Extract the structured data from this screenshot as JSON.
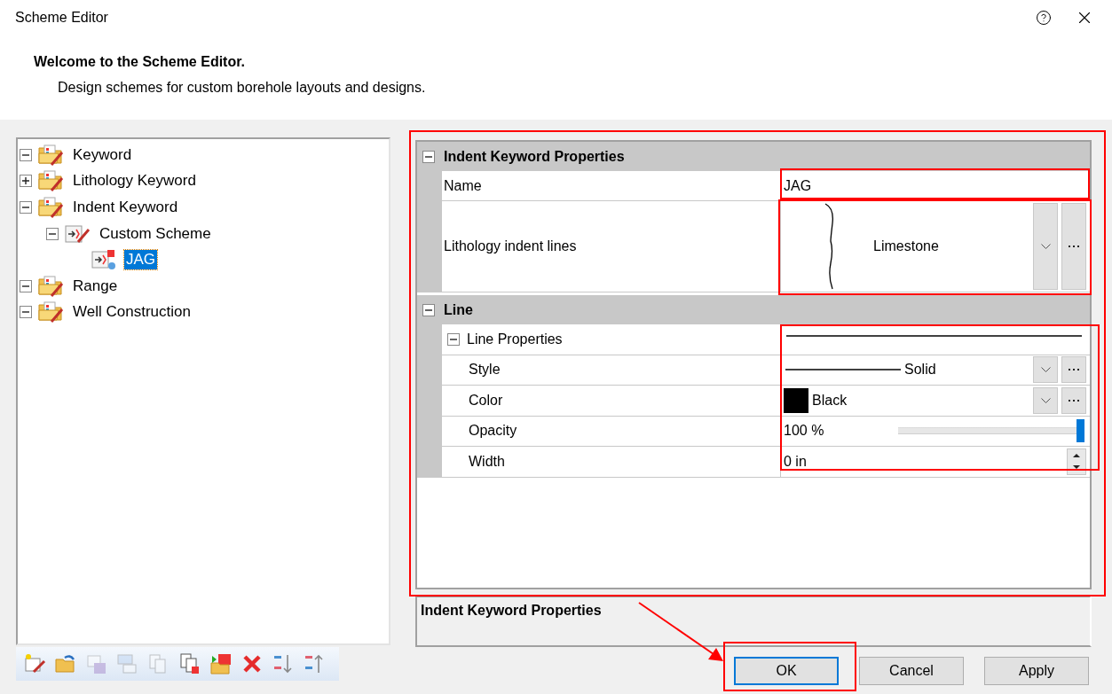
{
  "window": {
    "title": "Scheme Editor"
  },
  "header": {
    "title": "Welcome to the Scheme Editor.",
    "subtitle": "Design schemes for custom borehole layouts and designs."
  },
  "tree": [
    {
      "label": "Keyword",
      "kind": "folder",
      "expanded": true,
      "selected": false
    },
    {
      "label": "Lithology Keyword",
      "kind": "folder",
      "expanded": false,
      "selected": false
    },
    {
      "label": "Indent Keyword",
      "kind": "folder",
      "expanded": true,
      "selected": false,
      "children": [
        {
          "label": "Custom Scheme",
          "kind": "scheme",
          "expanded": true,
          "selected": false,
          "children": [
            {
              "label": "JAG",
              "kind": "item",
              "selected": true
            }
          ]
        }
      ]
    },
    {
      "label": "Range",
      "kind": "folder",
      "expanded": true,
      "selected": false
    },
    {
      "label": "Well Construction",
      "kind": "folder",
      "expanded": true,
      "selected": false
    }
  ],
  "toolbar": [
    {
      "kind": "new",
      "disabled": false
    },
    {
      "kind": "open",
      "disabled": false
    },
    {
      "kind": "save",
      "disabled": true
    },
    {
      "kind": "layout",
      "disabled": true
    },
    {
      "kind": "copy",
      "disabled": true
    },
    {
      "kind": "paste",
      "disabled": false
    },
    {
      "kind": "import",
      "disabled": false
    },
    {
      "kind": "delete",
      "disabled": false
    },
    {
      "kind": "sort-up",
      "disabled": false
    },
    {
      "kind": "sort-down",
      "disabled": false
    }
  ],
  "property_grid": {
    "categories": [
      {
        "title": "Indent Keyword Properties",
        "expanded": true,
        "rows": [
          {
            "kind": "text",
            "label": "Name",
            "value": "JAG"
          },
          {
            "kind": "lithology",
            "label": "Lithology indent lines",
            "value": "Limestone"
          }
        ]
      },
      {
        "title": "Line",
        "expanded": true,
        "rows": [
          {
            "kind": "group",
            "label": "Line Properties",
            "expanded": true
          },
          {
            "kind": "line-style",
            "label": "Style",
            "value": "Solid"
          },
          {
            "kind": "color",
            "label": "Color",
            "value": "Black",
            "color": "#000000"
          },
          {
            "kind": "slider",
            "label": "Opacity",
            "value": "100 %",
            "level": 1
          },
          {
            "kind": "spin",
            "label": "Width",
            "value": "0 in"
          }
        ]
      }
    ]
  },
  "description": {
    "title": "Indent Keyword Properties"
  },
  "buttons": [
    {
      "label": "OK",
      "default": true
    },
    {
      "label": "Cancel",
      "default": false
    },
    {
      "label": "Apply",
      "default": false
    }
  ]
}
